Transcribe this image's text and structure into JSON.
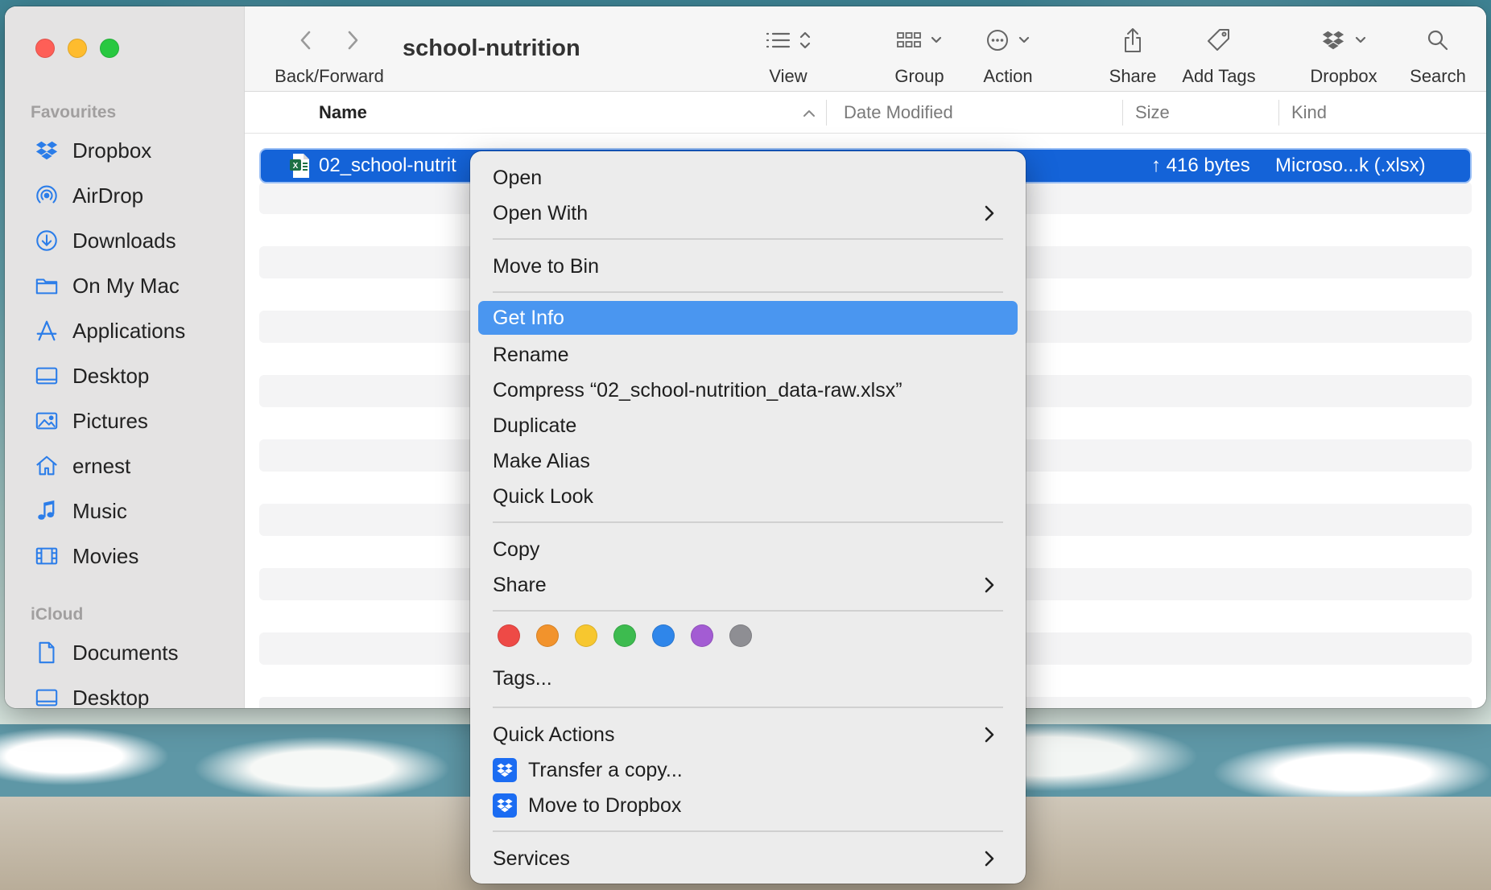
{
  "window": {
    "title": "school-nutrition"
  },
  "toolbar": {
    "back_forward": "Back/Forward",
    "view": "View",
    "group": "Group",
    "action": "Action",
    "share": "Share",
    "add_tags": "Add Tags",
    "dropbox": "Dropbox",
    "search": "Search"
  },
  "sidebar": {
    "favourites_header": "Favourites",
    "favourites": [
      {
        "label": "Dropbox",
        "icon": "dropbox-icon"
      },
      {
        "label": "AirDrop",
        "icon": "airdrop-icon"
      },
      {
        "label": "Downloads",
        "icon": "downloads-icon"
      },
      {
        "label": "On My Mac",
        "icon": "folder-icon"
      },
      {
        "label": "Applications",
        "icon": "applications-icon"
      },
      {
        "label": "Desktop",
        "icon": "desktop-icon"
      },
      {
        "label": "Pictures",
        "icon": "pictures-icon"
      },
      {
        "label": "ernest",
        "icon": "home-icon"
      },
      {
        "label": "Music",
        "icon": "music-icon"
      },
      {
        "label": "Movies",
        "icon": "movies-icon"
      }
    ],
    "icloud_header": "iCloud",
    "icloud": [
      {
        "label": "Documents",
        "icon": "document-icon"
      },
      {
        "label": "Desktop",
        "icon": "desktop-icon"
      }
    ]
  },
  "columns": {
    "name": "Name",
    "date_modified": "Date Modified",
    "size": "Size",
    "kind": "Kind"
  },
  "file": {
    "name": "02_school-nutrit",
    "size": "↑ 416 bytes",
    "kind": "Microso...k (.xlsx)",
    "icon": "excel-file-icon"
  },
  "context_menu": {
    "open": "Open",
    "open_with": "Open With",
    "move_to_bin": "Move to Bin",
    "get_info": "Get Info",
    "rename": "Rename",
    "compress": "Compress “02_school-nutrition_data-raw.xlsx”",
    "duplicate": "Duplicate",
    "make_alias": "Make Alias",
    "quick_look": "Quick Look",
    "copy": "Copy",
    "share": "Share",
    "tag_colors": [
      "#ee4a46",
      "#f2932c",
      "#f7c72f",
      "#3dbb4f",
      "#2f86ea",
      "#a35cd3",
      "#8e8e93"
    ],
    "tags": "Tags...",
    "quick_actions": "Quick Actions",
    "transfer_copy": "Transfer a copy...",
    "move_to_dropbox": "Move to Dropbox",
    "services": "Services"
  },
  "colors": {
    "accent": "#1463d8",
    "menu_highlight": "#4a96f0",
    "sidebar_icon": "#2b7de9"
  }
}
